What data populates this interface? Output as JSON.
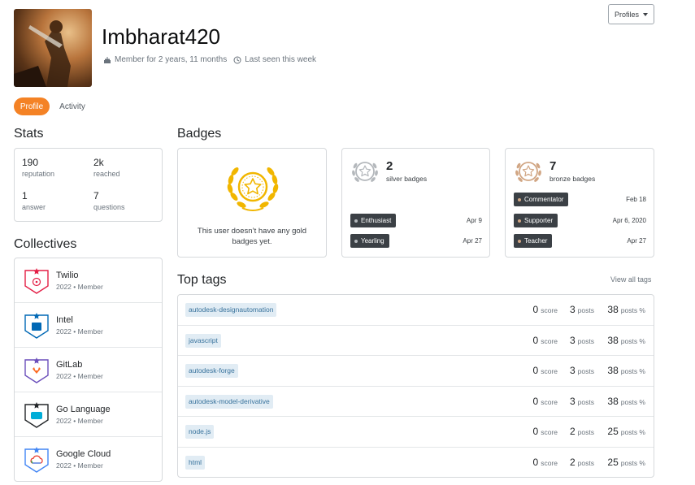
{
  "user": {
    "name": "Imbharat420",
    "member_for": "Member for 2 years, 11 months",
    "last_seen": "Last seen this week"
  },
  "header": {
    "profiles_label": "Profiles"
  },
  "tabs": [
    {
      "label": "Profile"
    },
    {
      "label": "Activity"
    }
  ],
  "stats": {
    "title": "Stats",
    "items": [
      {
        "value": "190",
        "label": "reputation"
      },
      {
        "value": "2k",
        "label": "reached"
      },
      {
        "value": "1",
        "label": "answer"
      },
      {
        "value": "7",
        "label": "questions"
      }
    ]
  },
  "collectives": {
    "title": "Collectives",
    "items": [
      {
        "name": "Twilio",
        "sub": "2022 • Member",
        "icon": "twilio-icon",
        "color": "#e31e45"
      },
      {
        "name": "Intel",
        "sub": "2022 • Member",
        "icon": "intel-icon",
        "color": "#0068b5"
      },
      {
        "name": "GitLab",
        "sub": "2022 • Member",
        "icon": "gitlab-icon",
        "color": "#6b4fbb"
      },
      {
        "name": "Go Language",
        "sub": "2022 • Member",
        "icon": "go-icon",
        "color": "#00add8"
      },
      {
        "name": "Google Cloud",
        "sub": "2022 • Member",
        "icon": "google-cloud-icon",
        "color": "#4285f4"
      }
    ]
  },
  "badges": {
    "title": "Badges",
    "gold": {
      "text": "This user doesn’t have any gold badges yet.",
      "color": "#f1b600"
    },
    "silver": {
      "count": "2",
      "label": "silver badges",
      "color": "#b4b8bc",
      "items": [
        {
          "name": "Enthusiast",
          "date": "Apr 9"
        },
        {
          "name": "Yearling",
          "date": "Apr 27"
        }
      ]
    },
    "bronze": {
      "count": "7",
      "label": "bronze badges",
      "color": "#d1a684",
      "items": [
        {
          "name": "Commentator",
          "date": "Feb 18"
        },
        {
          "name": "Supporter",
          "date": "Apr 6, 2020"
        },
        {
          "name": "Teacher",
          "date": "Apr 27"
        }
      ]
    }
  },
  "top_tags": {
    "title": "Top tags",
    "view_all": "View all tags",
    "score_label": "score",
    "posts_label": "posts",
    "pct_label": "posts %",
    "items": [
      {
        "tag": "autodesk-designautomation",
        "score": "0",
        "posts": "3",
        "pct": "38"
      },
      {
        "tag": "javascript",
        "score": "0",
        "posts": "3",
        "pct": "38"
      },
      {
        "tag": "autodesk-forge",
        "score": "0",
        "posts": "3",
        "pct": "38"
      },
      {
        "tag": "autodesk-model-derivative",
        "score": "0",
        "posts": "3",
        "pct": "38"
      },
      {
        "tag": "node.js",
        "score": "0",
        "posts": "2",
        "pct": "25"
      },
      {
        "tag": "html",
        "score": "0",
        "posts": "2",
        "pct": "25"
      }
    ]
  }
}
